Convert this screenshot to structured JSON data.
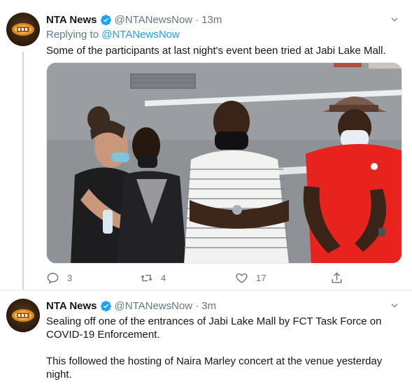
{
  "tweets": [
    {
      "author": "NTA News",
      "handle": "@NTANewsNow",
      "separator": "·",
      "time": "13m",
      "replying_label": "Replying to",
      "replying_to": "@NTANewsNow",
      "text": "Some of the participants at last night's event been tried at Jabi Lake Mall.",
      "metrics": {
        "replies": "3",
        "retweets": "4",
        "likes": "17"
      }
    },
    {
      "author": "NTA News",
      "handle": "@NTANewsNow",
      "separator": "·",
      "time": "3m",
      "text_lines": [
        "Sealing off one of the entrances of Jabi Lake Mall by FCT Task Force on",
        "COVID-19 Enforcement."
      ],
      "text_paragraph_2": [
        "This followed the hosting of Naira Marley concert at the venue yesterday",
        "night."
      ]
    }
  ],
  "icons": {
    "verified": "verified-badge-icon",
    "more": "chevron-down-icon",
    "reply": "reply-icon",
    "retweet": "retweet-icon",
    "like": "heart-icon",
    "share": "share-icon"
  },
  "colors": {
    "accent": "#1da1f2",
    "muted": "#657786",
    "text": "#14171a",
    "divider": "#e6ecf0"
  }
}
